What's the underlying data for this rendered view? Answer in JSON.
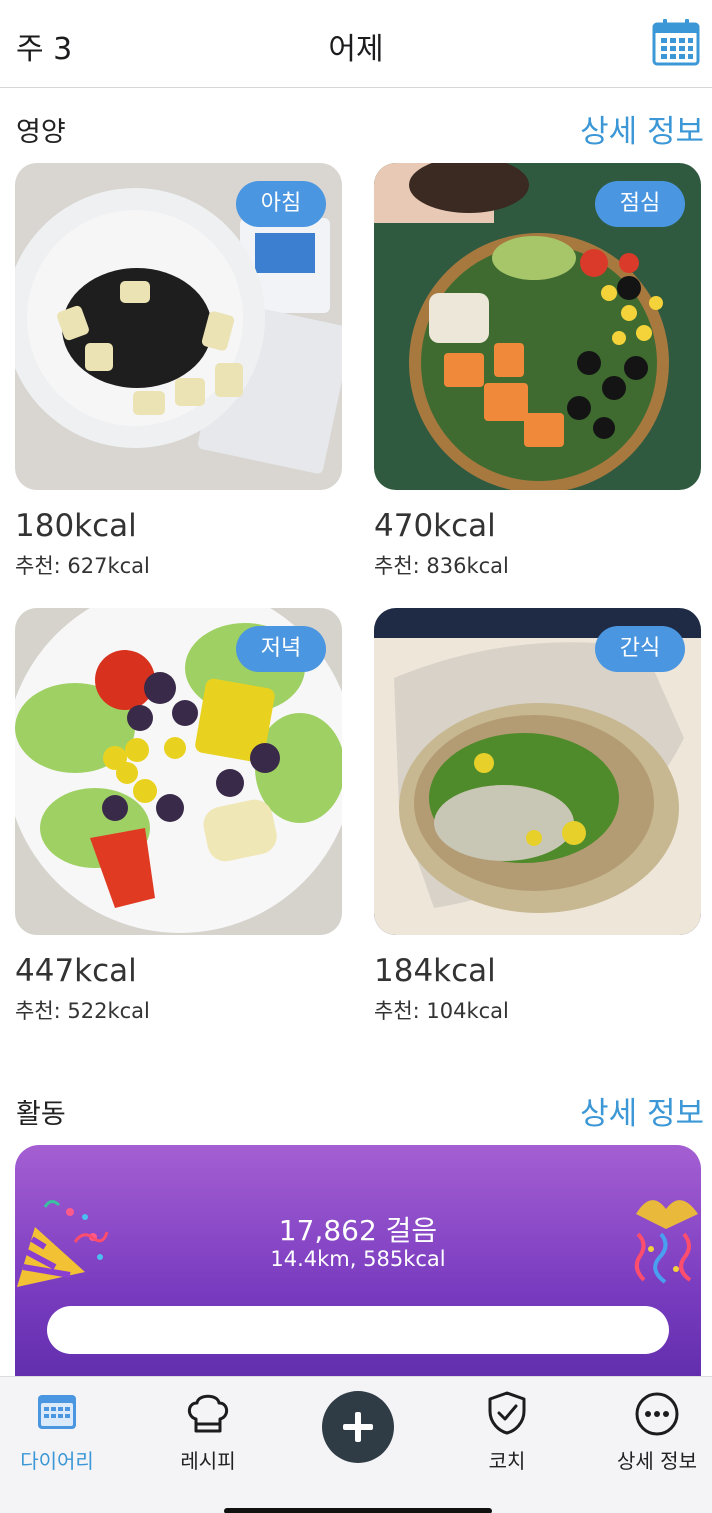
{
  "header": {
    "week": "주 3",
    "title": "어제",
    "calendar_icon": "calendar-icon"
  },
  "nutrition": {
    "title": "영양",
    "details_link": "상세 정보",
    "meals": [
      {
        "tag": "아침",
        "kcal": "180kcal",
        "recommended": "추천: 627kcal"
      },
      {
        "tag": "점심",
        "kcal": "470kcal",
        "recommended": "추천: 836kcal"
      },
      {
        "tag": "저녁",
        "kcal": "447kcal",
        "recommended": "추천: 522kcal"
      },
      {
        "tag": "간식",
        "kcal": "184kcal",
        "recommended": "추천: 104kcal"
      }
    ]
  },
  "activity": {
    "title": "활동",
    "details_link": "상세 정보",
    "steps": "17,862 걸음",
    "summary": "14.4km, 585kcal"
  },
  "tabbar": {
    "items": [
      {
        "label": "다이어리",
        "icon": "calendar-icon",
        "active": true
      },
      {
        "label": "레시피",
        "icon": "chef-hat-icon",
        "active": false
      },
      {
        "label": "",
        "icon": "plus-icon",
        "active": false
      },
      {
        "label": "코치",
        "icon": "shield-check-icon",
        "active": false
      },
      {
        "label": "상세 정보",
        "icon": "more-icon",
        "active": false
      }
    ]
  },
  "colors": {
    "accent": "#3b97d6",
    "badge": "#4a96e0",
    "activity_gradient_top": "#a45fd2",
    "activity_gradient_bottom": "#5a2aa8",
    "add_button": "#2f3b45"
  }
}
